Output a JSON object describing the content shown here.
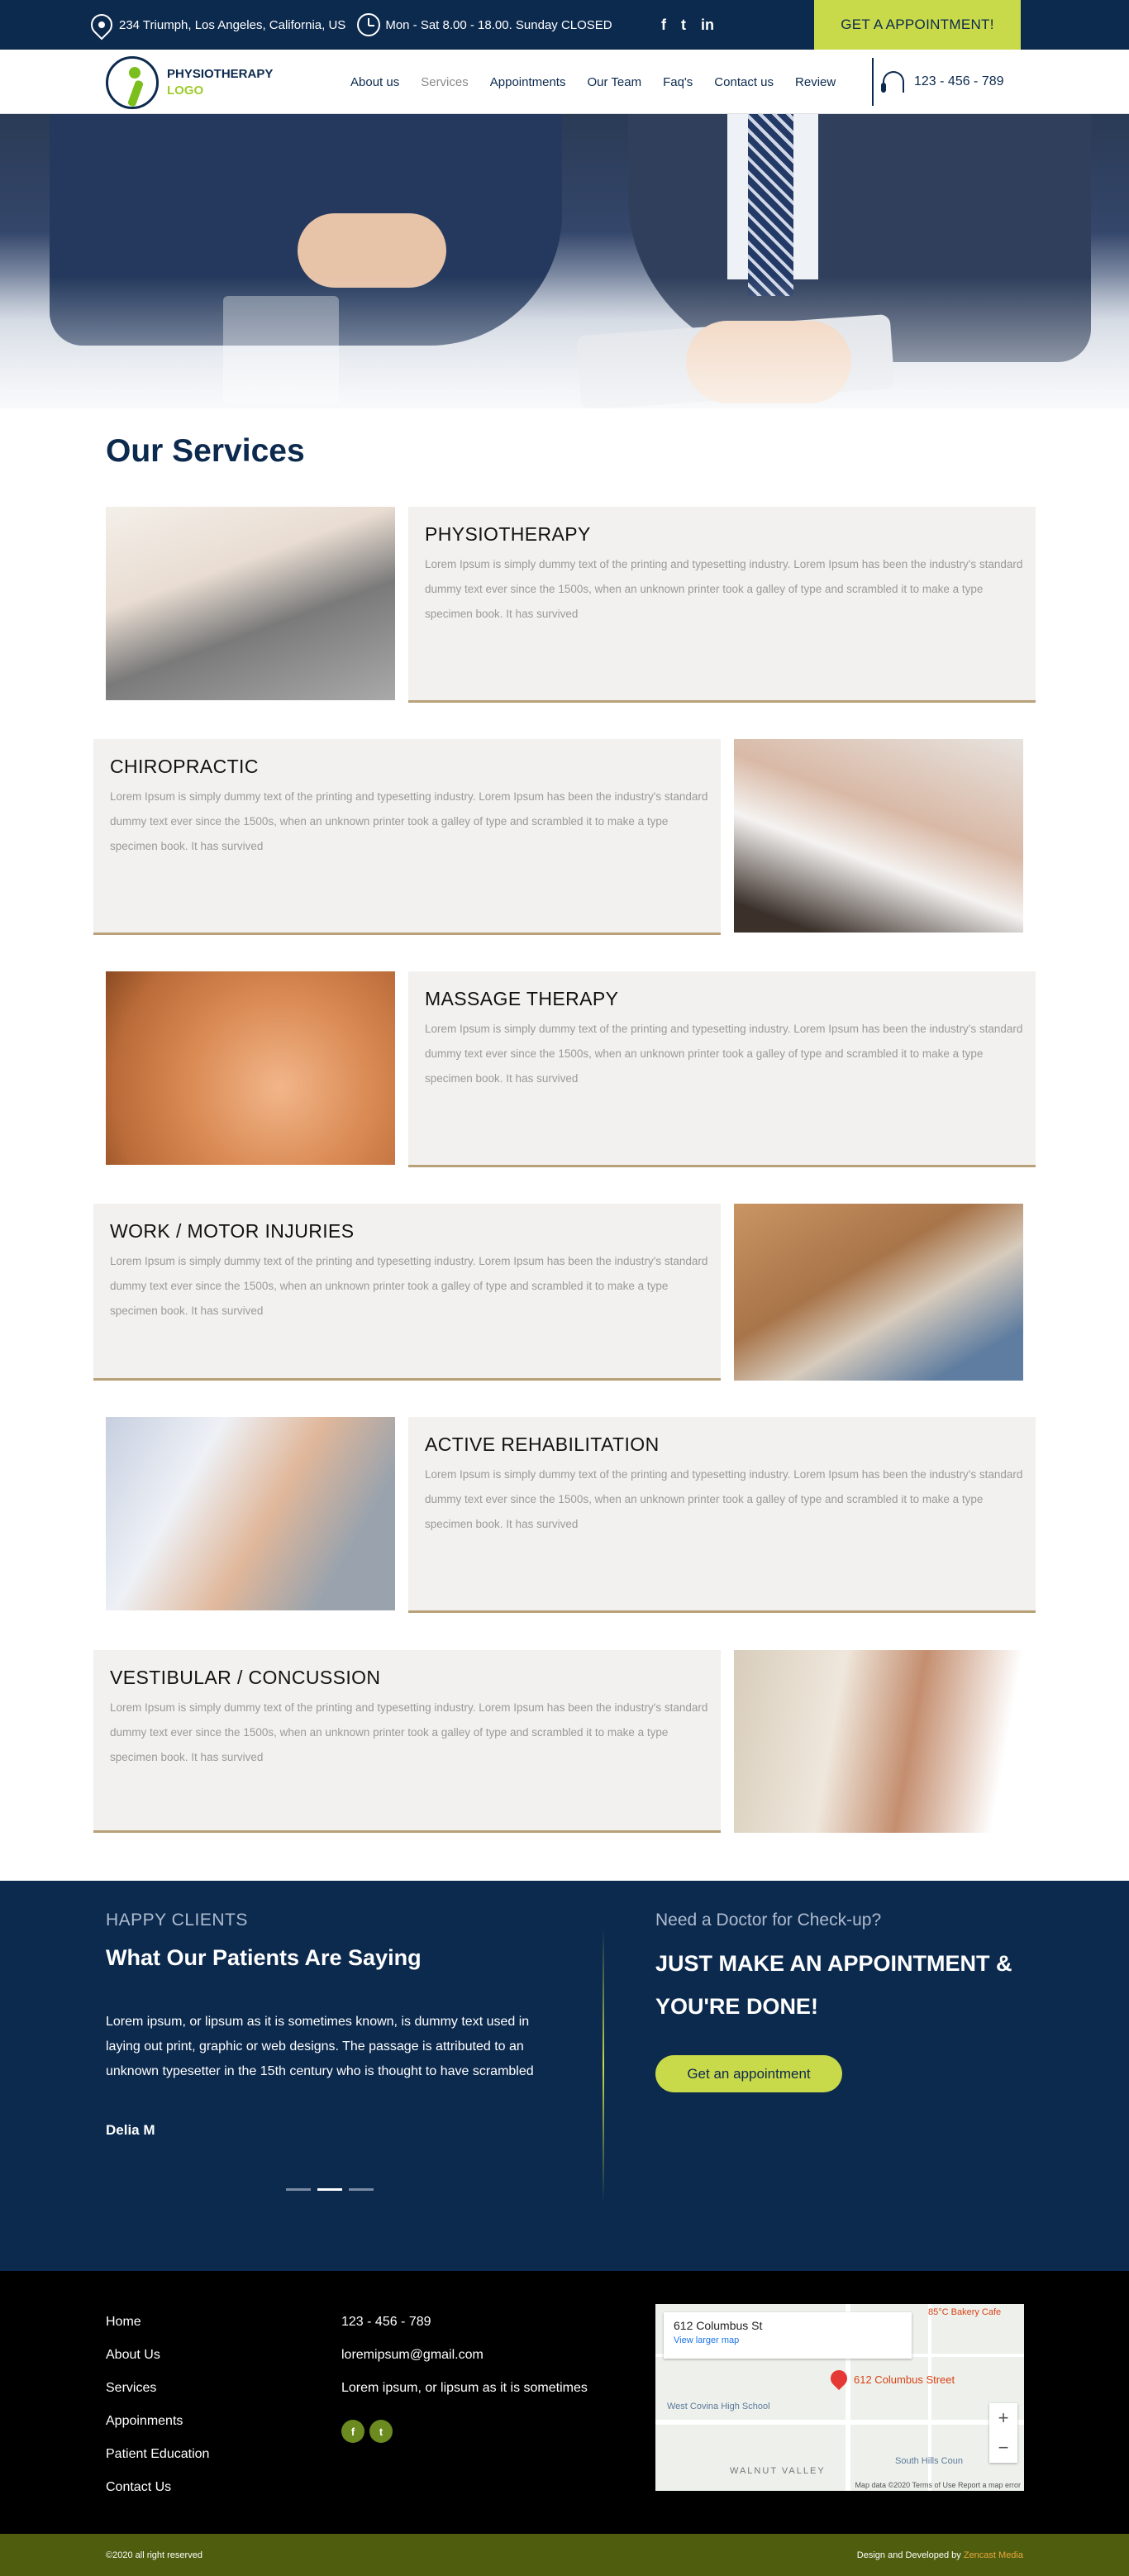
{
  "topbar": {
    "address": "234 Triumph, Los Angeles, California, US",
    "hours": "Mon - Sat 8.00 - 18.00. Sunday CLOSED",
    "social": [
      "f",
      "t",
      "in"
    ],
    "cta": "GET A APPOINTMENT!"
  },
  "nav": {
    "logo_title": "PHYSIOTHERAPY",
    "logo_sub": "LOGO",
    "items": [
      "About us",
      "Services",
      "Appointments",
      "Our Team",
      "Faq's",
      "Contact us",
      "Review"
    ],
    "phone": "123 - 456 - 789"
  },
  "services": {
    "title": "Our Services",
    "items": [
      {
        "title": "PHYSIOTHERAPY",
        "text": "Lorem Ipsum is simply dummy text of the printing and typesetting industry. Lorem Ipsum has been the industry's standard dummy text ever since the 1500s, when an unknown printer took a galley of type and scrambled it to make a type specimen book. It has survived"
      },
      {
        "title": "CHIROPRACTIC",
        "text": "Lorem Ipsum is simply dummy text of the printing and typesetting industry. Lorem Ipsum has been the industry's standard dummy text ever since the 1500s, when an unknown printer took a galley of type and scrambled it to make a type specimen book. It has survived"
      },
      {
        "title": "MASSAGE THERAPY",
        "text": "Lorem Ipsum is simply dummy text of the printing and typesetting industry. Lorem Ipsum has been the industry's standard dummy text ever since the 1500s, when an unknown printer took a galley of type and scrambled it to make a type specimen book. It has survived"
      },
      {
        "title": "WORK / MOTOR INJURIES",
        "text": "Lorem Ipsum is simply dummy text of the printing and typesetting industry. Lorem Ipsum has been the industry's standard dummy text ever since the 1500s, when an unknown printer took a galley of type and scrambled it to make a type specimen book. It has survived"
      },
      {
        "title": "ACTIVE REHABILITATION",
        "text": "Lorem Ipsum is simply dummy text of the printing and typesetting industry. Lorem Ipsum has been the industry's standard dummy text ever since the 1500s, when an unknown printer took a galley of type and scrambled it to make a type specimen book. It has survived"
      },
      {
        "title": "VESTIBULAR / CONCUSSION",
        "text": "Lorem Ipsum is simply dummy text of the printing and typesetting industry. Lorem Ipsum has been the industry's standard dummy text ever since the 1500s, when an unknown printer took a galley of type and scrambled it to make a type specimen book. It has survived"
      }
    ]
  },
  "testimonials": {
    "eyebrow": "HAPPY CLIENTS",
    "title": "What Our Patients Are Saying",
    "quote": "Lorem ipsum, or lipsum as it is sometimes known, is dummy text used in laying out print, graphic or web designs. The passage is attributed to an unknown typesetter in the 15th century who is thought to have scrambled",
    "author": "Delia M"
  },
  "checkup": {
    "eyebrow": "Need a Doctor for Check-up?",
    "title": "JUST MAKE AN APPOINTMENT & YOU'RE DONE!",
    "button": "Get an appointment"
  },
  "footer": {
    "links": [
      "Home",
      "About Us",
      "Services",
      "Appoinments",
      "Patient Education",
      "Contact Us"
    ],
    "phone": "123 - 456 - 789",
    "email": "loremipsum@gmail.com",
    "blurb": "Lorem ipsum, or lipsum as it is sometimes",
    "social": [
      "f",
      "t"
    ],
    "map": {
      "address": "612 Columbus St",
      "link": "View larger map",
      "pin_label": "612 Columbus Street",
      "place1": "West Covina High School",
      "place2": "WALNUT VALLEY",
      "place3": "85°C Bakery Cafe",
      "place4": "South Hills Coun",
      "terms": "Map data ©2020   Terms of Use   Report a map error"
    }
  },
  "bottom": {
    "copyright": "©2020 all right reserved",
    "credit_prefix": "Design and Developed by",
    "credit_brand": "Zencast Media"
  }
}
